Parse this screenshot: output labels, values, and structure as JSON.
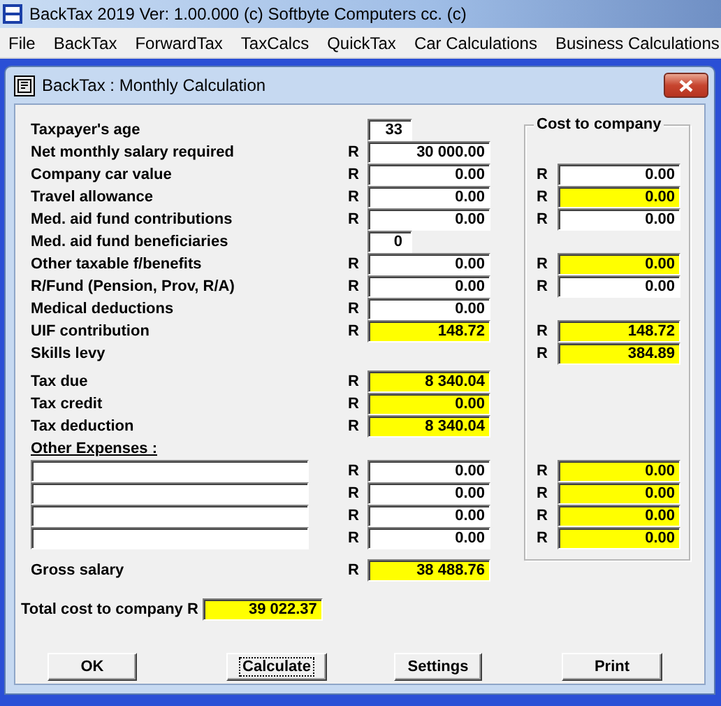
{
  "app": {
    "title": "BackTax 2019 Ver: 1.00.000  (c) Softbyte Computers cc. (c)"
  },
  "menu": [
    "File",
    "BackTax",
    "ForwardTax",
    "TaxCalcs",
    "QuickTax",
    "Car Calculations",
    "Business Calculations"
  ],
  "dialog": {
    "title": "BackTax : Monthly Calculation"
  },
  "cost_group": {
    "title": "Cost to company"
  },
  "rows": [
    {
      "label": "Taxpayer's age",
      "kind": "count",
      "value": "33"
    },
    {
      "label": "Net monthly salary required",
      "kind": "amount",
      "currency": "R",
      "value": "30 000.00",
      "highlighted": false
    },
    {
      "label": "Company car value",
      "kind": "amount",
      "currency": "R",
      "value": "0.00",
      "highlighted": false,
      "cost": {
        "currency": "R",
        "value": "0.00",
        "highlighted": false
      }
    },
    {
      "label": "Travel allowance",
      "kind": "amount",
      "currency": "R",
      "value": "0.00",
      "highlighted": false,
      "cost": {
        "currency": "R",
        "value": "0.00",
        "highlighted": true
      }
    },
    {
      "label": "Med. aid fund contributions",
      "kind": "amount",
      "currency": "R",
      "value": "0.00",
      "highlighted": false,
      "cost": {
        "currency": "R",
        "value": "0.00",
        "highlighted": false
      }
    },
    {
      "label": "Med. aid fund beneficiaries",
      "kind": "count",
      "value": "0"
    },
    {
      "label": "Other taxable f/benefits",
      "kind": "amount",
      "currency": "R",
      "value": "0.00",
      "highlighted": false,
      "cost": {
        "currency": "R",
        "value": "0.00",
        "highlighted": true
      }
    },
    {
      "label": "R/Fund (Pension, Prov, R/A)",
      "kind": "amount",
      "currency": "R",
      "value": "0.00",
      "highlighted": false,
      "cost": {
        "currency": "R",
        "value": "0.00",
        "highlighted": false
      }
    },
    {
      "label": "Medical deductions",
      "kind": "amount",
      "currency": "R",
      "value": "0.00",
      "highlighted": false
    },
    {
      "label": "UIF contribution",
      "kind": "amount",
      "currency": "R",
      "value": "148.72",
      "highlighted": true,
      "cost": {
        "currency": "R",
        "value": "148.72",
        "highlighted": true
      }
    },
    {
      "label": "Skills levy",
      "kind": "cost_only",
      "cost": {
        "currency": "R",
        "value": "384.89",
        "highlighted": true
      }
    }
  ],
  "tax_rows": [
    {
      "label": "Tax due",
      "kind": "amount",
      "currency": "R",
      "value": "8 340.04",
      "highlighted": true
    },
    {
      "label": "Tax credit",
      "kind": "amount",
      "currency": "R",
      "value": "0.00",
      "highlighted": true
    },
    {
      "label": "Tax deduction",
      "kind": "amount",
      "currency": "R",
      "value": "8 340.04",
      "highlighted": true
    }
  ],
  "other_expenses": {
    "heading": "Other Expenses :",
    "rows": [
      {
        "kind": "amount",
        "currency": "R",
        "value": "0.00",
        "highlighted": false,
        "cost": {
          "currency": "R",
          "value": "0.00",
          "highlighted": true
        }
      },
      {
        "kind": "amount",
        "currency": "R",
        "value": "0.00",
        "highlighted": false,
        "cost": {
          "currency": "R",
          "value": "0.00",
          "highlighted": true
        }
      },
      {
        "kind": "amount",
        "currency": "R",
        "value": "0.00",
        "highlighted": false,
        "cost": {
          "currency": "R",
          "value": "0.00",
          "highlighted": true
        }
      },
      {
        "kind": "amount",
        "currency": "R",
        "value": "0.00",
        "highlighted": false,
        "cost": {
          "currency": "R",
          "value": "0.00",
          "highlighted": true
        }
      }
    ]
  },
  "gross": {
    "label": "Gross salary",
    "currency": "R",
    "value": "38 488.76",
    "highlighted": true
  },
  "total": {
    "label": "Total cost to company R",
    "value": "39 022.37",
    "highlighted": true
  },
  "buttons": [
    {
      "label": "OK",
      "focused": false
    },
    {
      "label": "Calculate",
      "focused": true
    },
    {
      "label": "Settings",
      "focused": false
    },
    {
      "label": "Print",
      "focused": false
    }
  ]
}
